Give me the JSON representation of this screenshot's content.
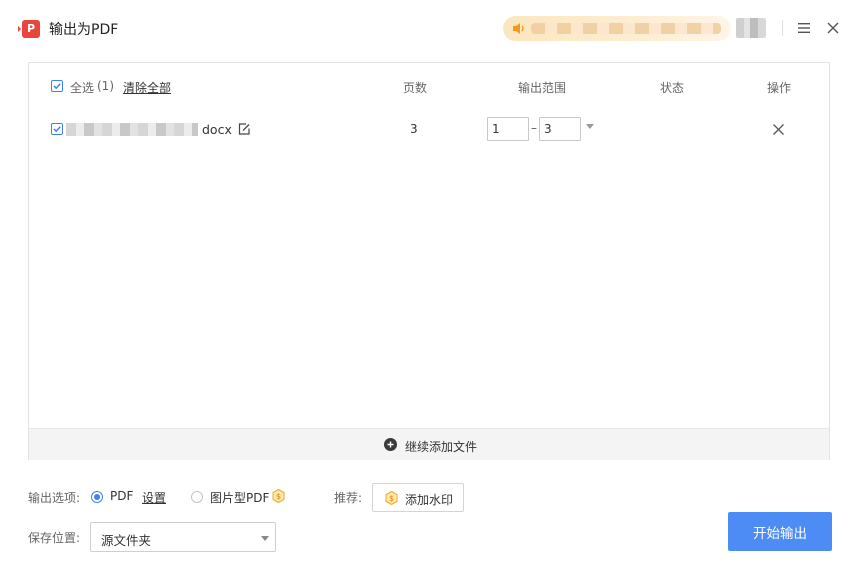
{
  "window": {
    "title": "输出为PDF",
    "app_icon_glyph": "P",
    "accent_color": "#4d8cf5",
    "brand_color": "#e8453c"
  },
  "table": {
    "select_all_label": "全选",
    "select_count": "(1)",
    "clear_all_label": "清除全部",
    "columns": {
      "pages": "页数",
      "range": "输出范围",
      "status": "状态",
      "actions": "操作"
    },
    "rows": [
      {
        "checked": true,
        "file_ext": "docx",
        "pages": "3",
        "range_from": "1",
        "range_sep": "–",
        "range_to": "3",
        "status": ""
      }
    ],
    "add_more_label": "继续添加文件"
  },
  "options": {
    "output_options_label": "输出选项:",
    "pdf_label": "PDF",
    "settings_label": "设置",
    "image_pdf_label": "图片型PDF",
    "selected": "PDF",
    "recommend_label": "推荐:",
    "watermark_label": "添加水印"
  },
  "save": {
    "location_label": "保存位置:",
    "location_value": "源文件夹"
  },
  "start_button_label": "开始输出"
}
